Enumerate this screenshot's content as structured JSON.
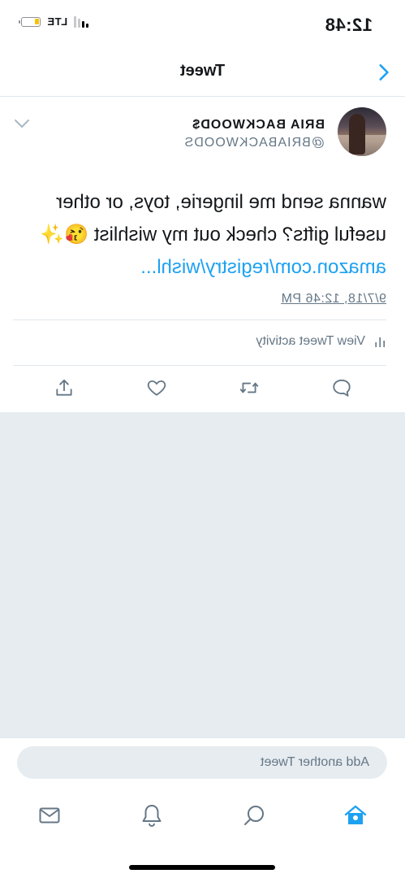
{
  "status_bar": {
    "time": "12:48",
    "network": "LTE",
    "signal_bars_filled": 2,
    "signal_bars_total": 4,
    "battery_level": 0.25,
    "battery_color": "#f5c400"
  },
  "nav": {
    "title": "Tweet",
    "back_icon": "chevron-left-icon",
    "accent": "#1da1f2"
  },
  "tweet": {
    "display_name": "BRIA BACKWOOD$",
    "handle": "@BRIABACKWOODS",
    "text": "wanna send me lingerie, toys, or other useful gifts? check out my wishlist 😘✨",
    "link": "amazon.com/registry/wishl...",
    "timestamp": "9/7/18, 12:46 PM",
    "activity_label": "View Tweet activity",
    "menu_icon": "chevron-down-icon"
  },
  "actions": {
    "reply_icon": "reply-icon",
    "retweet_icon": "retweet-icon",
    "like_icon": "heart-icon",
    "share_icon": "share-icon"
  },
  "composer": {
    "placeholder": "Add another Tweet"
  },
  "tabs": {
    "home": "home-icon",
    "search": "search-icon",
    "notifications": "bell-icon",
    "messages": "mail-icon",
    "active": "home"
  }
}
